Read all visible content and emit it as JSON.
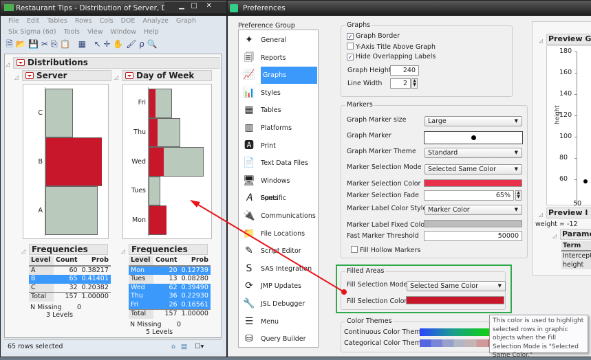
{
  "left_window": {
    "title": "Restaurant Tips - Distribution of Server, Day of ...",
    "menu1": [
      "File",
      "Edit",
      "Tables",
      "Rows",
      "Cols",
      "DOE",
      "Analyze",
      "Graph"
    ],
    "menu2": [
      "Six Sigma (6σ)",
      "Tools",
      "View",
      "Window",
      "Help"
    ],
    "distributions_title": "Distributions",
    "server": {
      "title": "Server",
      "categories": [
        "C",
        "B",
        "A"
      ],
      "counts": [
        32,
        65,
        60
      ],
      "selected": [
        0,
        65,
        0
      ]
    },
    "day": {
      "title": "Day of Week",
      "categories": [
        "Fri",
        "Thu",
        "Wed",
        "Tues",
        "Mon"
      ],
      "counts": [
        26,
        36,
        62,
        13,
        20
      ],
      "selected": [
        8,
        10,
        17,
        0,
        20
      ]
    },
    "freq_server": {
      "title": "Frequencies",
      "headers": [
        "Level",
        "Count",
        "Prob"
      ],
      "rows": [
        [
          "A",
          "60",
          "0.38217"
        ],
        [
          "B",
          "65",
          "0.41401"
        ],
        [
          "C",
          "32",
          "0.20382"
        ]
      ],
      "selected_rows": [
        1
      ],
      "total": [
        "Total",
        "157",
        "1.00000"
      ],
      "n_missing_label": "N Missing",
      "n_missing": "0",
      "levels": "3  Levels"
    },
    "freq_day": {
      "title": "Frequencies",
      "headers": [
        "Level",
        "Count",
        "Prob"
      ],
      "rows": [
        [
          "Mon",
          "20",
          "0.12739"
        ],
        [
          "Tues",
          "13",
          "0.08280"
        ],
        [
          "Wed",
          "62",
          "0.39490"
        ],
        [
          "Thu",
          "36",
          "0.22930"
        ],
        [
          "Fri",
          "26",
          "0.16561"
        ]
      ],
      "selected_rows": [
        0,
        2,
        3,
        4
      ],
      "total": [
        "Total",
        "157",
        "1.00000"
      ],
      "n_missing_label": "N Missing",
      "n_missing": "0",
      "levels": "5  Levels"
    },
    "status": "65 rows selected"
  },
  "prefs": {
    "title": "Preferences",
    "group_label": "Preference Group",
    "groups": [
      "General",
      "Reports",
      "Graphs",
      "Styles",
      "Tables",
      "Platforms",
      "Print",
      "Text Data Files",
      "Windows Specific",
      "Fonts",
      "Communications",
      "File Locations",
      "Script Editor",
      "SAS Integration",
      "JMP Updates",
      "JSL Debugger",
      "Menu",
      "Query Builder"
    ],
    "selected_group": "Graphs",
    "graphs": {
      "legend": "Graphs",
      "graph_border": "Graph Border",
      "graph_border_checked": true,
      "y_axis_title": "Y-Axis Title Above Graph",
      "y_axis_checked": false,
      "hide_overlap": "Hide Overlapping Labels",
      "hide_overlap_checked": true,
      "graph_height_label": "Graph Height",
      "graph_height": "240",
      "line_width_label": "Line Width",
      "line_width": "2"
    },
    "markers": {
      "legend": "Markers",
      "size_label": "Graph Marker size",
      "size": "Large",
      "marker_label": "Graph Marker",
      "theme_label": "Graph Marker Theme",
      "theme": "Standard",
      "mode_label": "Marker Selection Mode",
      "mode": "Selected Same Color",
      "color_label": "Marker Selection Color",
      "color": "#e8304a",
      "fade_label": "Marker Selection Fade",
      "fade": "65%",
      "label_style_label": "Marker Label Color Style",
      "label_style": "Marker Color",
      "fixed_color_label": "Marker Label Fixed Color",
      "fixed_color": "#bcbcbc",
      "threshold_label": "Fast Marker Threshold",
      "threshold": "50000",
      "fill_hollow": "Fill Hollow Markers"
    },
    "filled": {
      "legend": "Filled Areas",
      "mode_label": "Fill Selection Mode",
      "mode": "Selected Same Color",
      "color_label": "Fill Selection Color",
      "color": "#c8172b"
    },
    "themes": {
      "legend": "Color Themes",
      "continuous": "Continuous Color Theme",
      "categorical": "Categorical Color Theme"
    },
    "tooltip": "This color is used to highlight selected rows in graphic objects when the Fill Selection Mode is \"Selected Same Color.\"",
    "preview": {
      "title": "Preview Gr",
      "yaxis": "height",
      "yticks": [
        "180",
        "160",
        "140",
        "120",
        "100",
        "80",
        "60"
      ],
      "xtick": "50",
      "report_title": "Preview I",
      "equation": "weight = -12",
      "params_title": "Parame",
      "term_header": "Term",
      "terms": [
        "Intercept",
        "height"
      ]
    }
  }
}
